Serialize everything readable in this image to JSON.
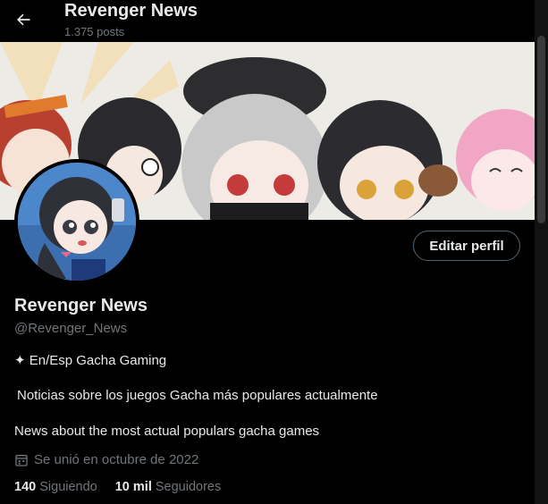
{
  "header": {
    "title": "Revenger News",
    "post_count": "1.375 posts",
    "back_icon": "arrow-left-icon"
  },
  "banner": {
    "description_icon": "banner-image"
  },
  "profile": {
    "name": "Revenger News",
    "handle": "@Revenger_News",
    "edit_button": "Editar perfil",
    "bio_line1": "✦ En/Esp Gacha Gaming",
    "bio_line2": "Noticias sobre los juegos Gacha más populares actualmente",
    "bio_line3": "News about the most actual populars gacha games",
    "joined": "Se unió en octubre de 2022",
    "following_count": "140",
    "following_label": "Siguiendo",
    "followers_count": "10 mil",
    "followers_label": "Seguidores"
  },
  "colors": {
    "background": "#000000",
    "text_primary": "#e7e9ea",
    "text_secondary": "#71767b",
    "button_border": "#536471"
  }
}
